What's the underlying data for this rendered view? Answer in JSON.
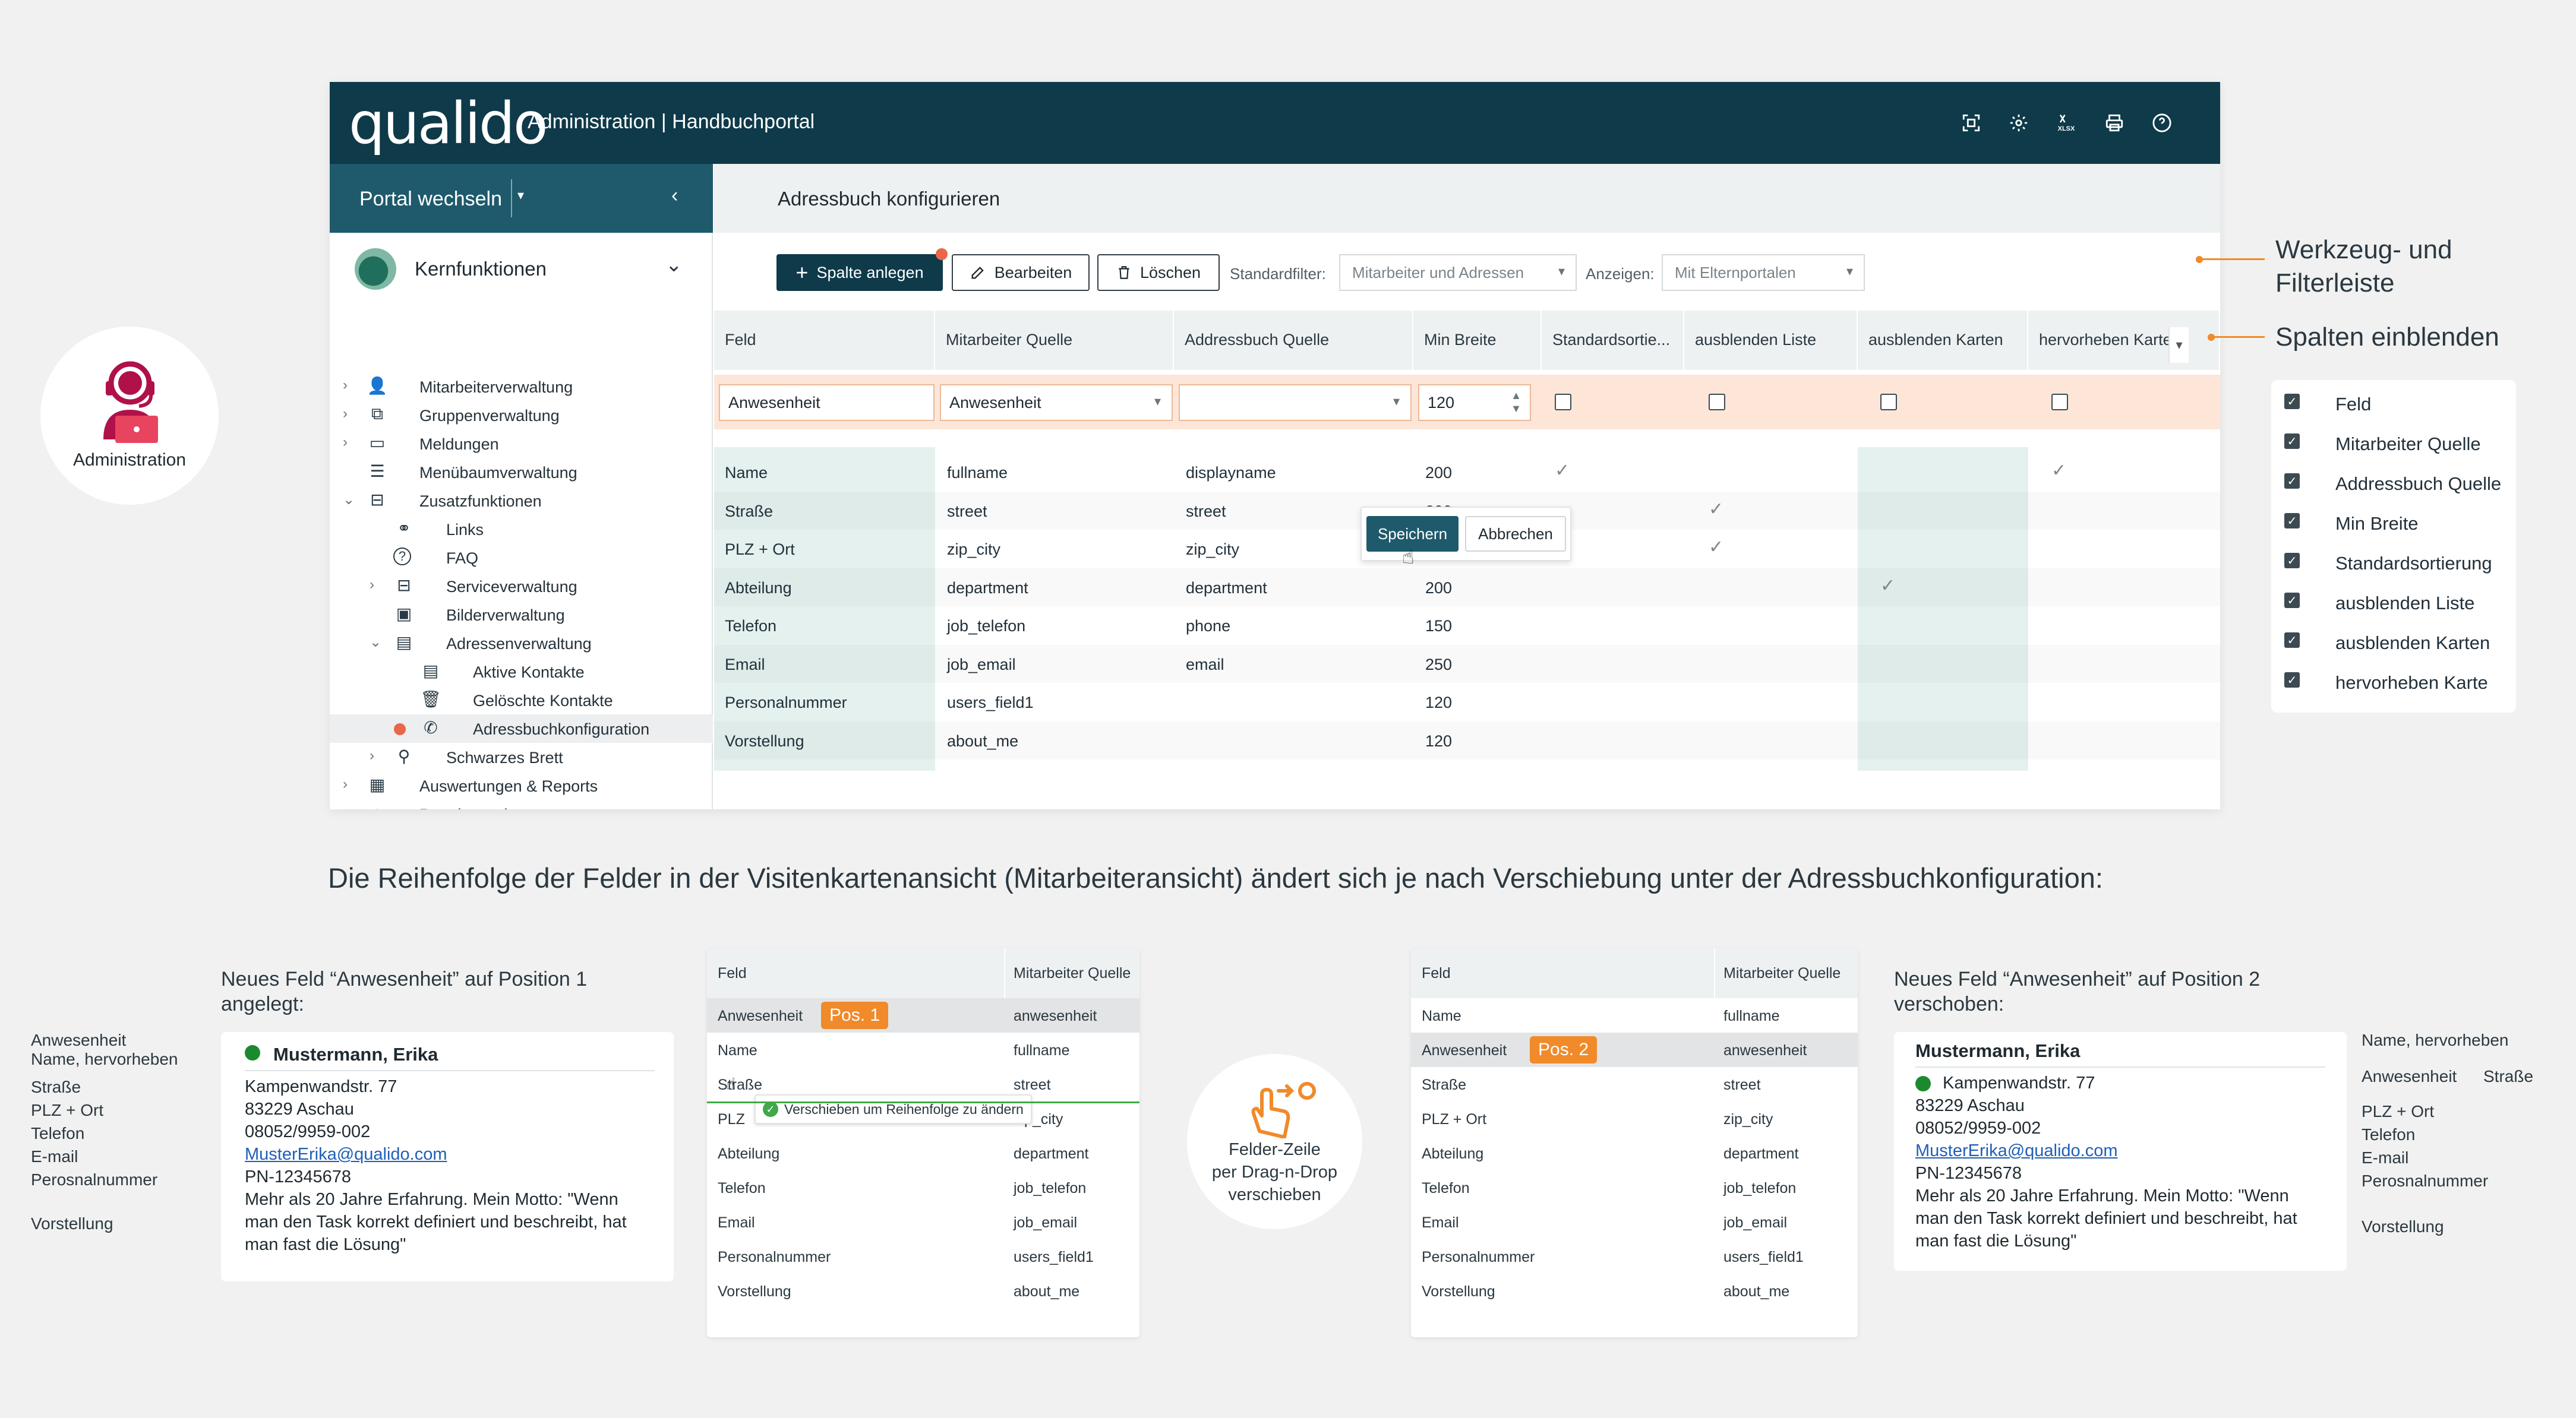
{
  "app": {
    "logo": "qualido",
    "title": "Administration | Handbuchportal",
    "top_icons": [
      "scan-icon",
      "gear-icon",
      "xlsx-icon",
      "print-icon",
      "help-icon"
    ],
    "xlsx_label": "XLSX"
  },
  "sidebar": {
    "portal_switch": "Portal wechseln",
    "section": "Kernfunktionen",
    "items": [
      {
        "label": "Mitarbeiterverwaltung",
        "icon": "user-icon",
        "level": 0,
        "chevron": "›"
      },
      {
        "label": "Gruppenverwaltung",
        "icon": "group-icon",
        "level": 0,
        "chevron": "›"
      },
      {
        "label": "Meldungen",
        "icon": "message-icon",
        "level": 0,
        "chevron": "›"
      },
      {
        "label": "Menübaumverwaltung",
        "icon": "list-icon",
        "level": 0,
        "chevron": ""
      },
      {
        "label": "Zusatzfunktionen",
        "icon": "book-icon",
        "level": 0,
        "chevron": "⌄"
      },
      {
        "label": "Links",
        "icon": "link-icon",
        "level": 1,
        "chevron": ""
      },
      {
        "label": "FAQ",
        "icon": "question-icon",
        "level": 1,
        "chevron": ""
      },
      {
        "label": "Serviceverwaltung",
        "icon": "service-icon",
        "level": 1,
        "chevron": "›"
      },
      {
        "label": "Bilderverwaltung",
        "icon": "image-icon",
        "level": 1,
        "chevron": ""
      },
      {
        "label": "Adressenverwaltung",
        "icon": "address-icon",
        "level": 1,
        "chevron": "⌄"
      },
      {
        "label": "Aktive Kontakte",
        "icon": "contact-card-icon",
        "level": 2,
        "chevron": ""
      },
      {
        "label": "Gelöschte Kontakte",
        "icon": "trash-icon",
        "level": 2,
        "chevron": ""
      },
      {
        "label": "Adressbuchkonfiguration",
        "icon": "phone-icon",
        "level": 2,
        "chevron": "",
        "active": true
      },
      {
        "label": "Schwarzes Brett",
        "icon": "pin-icon",
        "level": 1,
        "chevron": "›"
      },
      {
        "label": "Auswertungen & Reports",
        "icon": "report-icon",
        "level": 0,
        "chevron": "›"
      },
      {
        "label": "Portalverwaltung",
        "icon": "home-icon",
        "level": 0,
        "chevron": ""
      }
    ]
  },
  "content": {
    "title": "Adressbuch konfigurieren",
    "toolbar": {
      "add_label": "Spalte anlegen",
      "edit_label": "Bearbeiten",
      "delete_label": "Löschen",
      "filter_label": "Standardfilter:",
      "filter_value": "Mitarbeiter und Adressen",
      "show_label": "Anzeigen:",
      "show_value": "Mit Elternportalen"
    },
    "table": {
      "headers": [
        "Feld",
        "Mitarbeiter Quelle",
        "Addressbuch Quelle",
        "Min Breite",
        "Standardsortie...",
        "ausblenden Liste",
        "ausblenden Karten",
        "hervorheben Karte"
      ],
      "input_row": {
        "feld": "Anwesenheit",
        "mitarbeiter": "Anwesenheit",
        "adressbuch": "",
        "min_breite": "120"
      },
      "rows": [
        {
          "feld": "Name",
          "mitarbeiter": "fullname",
          "adressbuch": "displayname",
          "min": "",
          "sort": true,
          "hide_list": false,
          "hide_cards": false,
          "highlight": true
        },
        {
          "feld": "Straße",
          "mitarbeiter": "street",
          "adressbuch": "street",
          "min": "200",
          "sort": false,
          "hide_list": true,
          "hide_cards": false,
          "highlight": false
        },
        {
          "feld": "PLZ + Ort",
          "mitarbeiter": "zip_city",
          "adressbuch": "zip_city",
          "min": "200",
          "sort": false,
          "hide_list": true,
          "hide_cards": false,
          "highlight": false
        },
        {
          "feld": "Abteilung",
          "mitarbeiter": "department",
          "adressbuch": "department",
          "min": "200",
          "sort": false,
          "hide_list": false,
          "hide_cards": true,
          "highlight": false
        },
        {
          "feld": "Telefon",
          "mitarbeiter": "job_telefon",
          "adressbuch": "phone",
          "min": "150",
          "sort": false,
          "hide_list": false,
          "hide_cards": false,
          "highlight": false
        },
        {
          "feld": "Email",
          "mitarbeiter": "job_email",
          "adressbuch": "email",
          "min": "250",
          "sort": false,
          "hide_list": false,
          "hide_cards": false,
          "highlight": false
        },
        {
          "feld": "Personalnummer",
          "mitarbeiter": "users_field1",
          "adressbuch": "",
          "min": "120",
          "sort": false,
          "hide_list": false,
          "hide_cards": false,
          "highlight": false
        },
        {
          "feld": "Vorstellung",
          "mitarbeiter": "about_me",
          "adressbuch": "",
          "min": "120",
          "sort": false,
          "hide_list": false,
          "hide_cards": false,
          "highlight": false
        }
      ],
      "row_name_min": "200",
      "save_label": "Speichern",
      "cancel_label": "Abbrechen"
    }
  },
  "admin_badge": {
    "label": "Administration"
  },
  "annotations": {
    "toolbar": "Werkzeug- und Filterleiste",
    "columns": "Spalten einblenden",
    "column_options": [
      "Feld",
      "Mitarbeiter Quelle",
      "Addressbuch Quelle",
      "Min Breite",
      "Standardsortierung",
      "ausblenden Liste",
      "ausblenden Karten",
      "hervorheben Karte"
    ]
  },
  "caption": "Die Reihenfolge der Felder in der Visitenkartenansicht (Mitarbeiteransicht) ändert sich je nach Verschiebung unter der Adressbuchkonfiguration:",
  "example_left": {
    "heading": "Neues Feld “Anwesenheit” auf Position 1 angelegt:",
    "side_labels": [
      "Anwesenheit",
      "Name, hervorheben",
      "Straße",
      "PLZ + Ort",
      "Telefon",
      "E-mail",
      "Perosnalnummer",
      "Vorstellung"
    ],
    "card": {
      "name": "Mustermann, Erika",
      "street": "Kampenwandstr. 77",
      "city": "83229 Aschau",
      "phone": "08052/9959-002",
      "email": "MusterErika@qualido.com",
      "pn": "PN-12345678",
      "about": [
        "Mehr als 20 Jahre Erfahrung. Mein Motto: \"Wenn",
        "man den Task korrekt definiert und beschreibt, hat",
        "man fast die Lösung\""
      ]
    },
    "table": {
      "headers": [
        "Feld",
        "Mitarbeiter Quelle"
      ],
      "badge": "Pos. 1",
      "tooltip": "Verschieben um Reihenfolge zu ändern",
      "rows": [
        [
          "Anwesenheit",
          "anwesenheit"
        ],
        [
          "Name",
          "fullname"
        ],
        [
          "Straße",
          "street"
        ],
        [
          "PLZ",
          "zip_city"
        ],
        [
          "Abteilung",
          "department"
        ],
        [
          "Telefon",
          "job_telefon"
        ],
        [
          "Email",
          "job_email"
        ],
        [
          "Personalnummer",
          "users_field1"
        ],
        [
          "Vorstellung",
          "about_me"
        ]
      ]
    }
  },
  "dnd": {
    "label": [
      "Felder-Zeile",
      "per Drag-n-Drop",
      "verschieben"
    ]
  },
  "example_right": {
    "heading": "Neues Feld “Anwesenheit” auf Position 2 verschoben:",
    "side_labels": [
      "Name, hervorheben",
      "Anwesenheit",
      "Straße",
      "PLZ + Ort",
      "Telefon",
      "E-mail",
      "Perosnalnummer",
      "Vorstellung"
    ],
    "card": {
      "name": "Mustermann, Erika",
      "street": "Kampenwandstr. 77",
      "city": "83229 Aschau",
      "phone": "08052/9959-002",
      "email": "MusterErika@qualido.com",
      "pn": "PN-12345678",
      "about": [
        "Mehr als 20 Jahre Erfahrung. Mein Motto: \"Wenn",
        "man den Task korrekt definiert und beschreibt, hat",
        "man fast die Lösung\""
      ]
    },
    "table": {
      "headers": [
        "Feld",
        "Mitarbeiter Quelle"
      ],
      "badge": "Pos. 2",
      "rows": [
        [
          "Name",
          "fullname"
        ],
        [
          "Anwesenheit",
          "anwesenheit"
        ],
        [
          "Straße",
          "street"
        ],
        [
          "PLZ + Ort",
          "zip_city"
        ],
        [
          "Abteilung",
          "department"
        ],
        [
          "Telefon",
          "job_telefon"
        ],
        [
          "Email",
          "job_email"
        ],
        [
          "Personalnummer",
          "users_field1"
        ],
        [
          "Vorstellung",
          "about_me"
        ]
      ]
    }
  },
  "colors": {
    "brand": "#0e3a4a",
    "accent": "#f08a2a",
    "active_dot": "#e8664a",
    "status_green": "#1b8a2e"
  }
}
